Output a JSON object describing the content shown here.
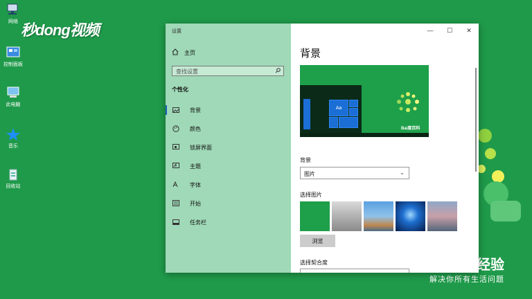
{
  "desktop": {
    "icons": [
      {
        "label": "网络",
        "icon": "network-icon"
      },
      {
        "label": "控制面板",
        "icon": "control-panel-icon"
      },
      {
        "label": "此电脑",
        "icon": "computer-icon"
      },
      {
        "label": "音乐",
        "icon": "star-icon"
      },
      {
        "label": "回收站",
        "icon": "recycle-bin-icon"
      }
    ],
    "watermark": "秒dong视频",
    "corner_text": "经验",
    "corner_sub": "解决你所有生活问题"
  },
  "window": {
    "title": "设置",
    "controls": {
      "minimize": "—",
      "maximize": "☐",
      "close": "✕"
    }
  },
  "sidebar": {
    "home_label": "主页",
    "search_placeholder": "查找设置",
    "section_title": "个性化",
    "items": [
      {
        "label": "背景",
        "icon": "picture-icon",
        "active": true
      },
      {
        "label": "颜色",
        "icon": "palette-icon"
      },
      {
        "label": "锁屏界面",
        "icon": "lock-screen-icon"
      },
      {
        "label": "主题",
        "icon": "theme-icon"
      },
      {
        "label": "字体",
        "icon": "font-icon"
      },
      {
        "label": "开始",
        "icon": "start-icon"
      },
      {
        "label": "任务栏",
        "icon": "taskbar-icon"
      }
    ]
  },
  "main": {
    "page_title": "背景",
    "preview_tile_text": "Aa",
    "preview_brand": "Bai度百科",
    "background_label": "背景",
    "background_value": "图片",
    "choose_picture_label": "选择图片",
    "browse_label": "浏览",
    "fit_label": "选择契合度"
  },
  "colors": {
    "desktop": "#1f9a4a",
    "sidebar": "#9fd9b7",
    "accent": "#1a6ed6"
  }
}
